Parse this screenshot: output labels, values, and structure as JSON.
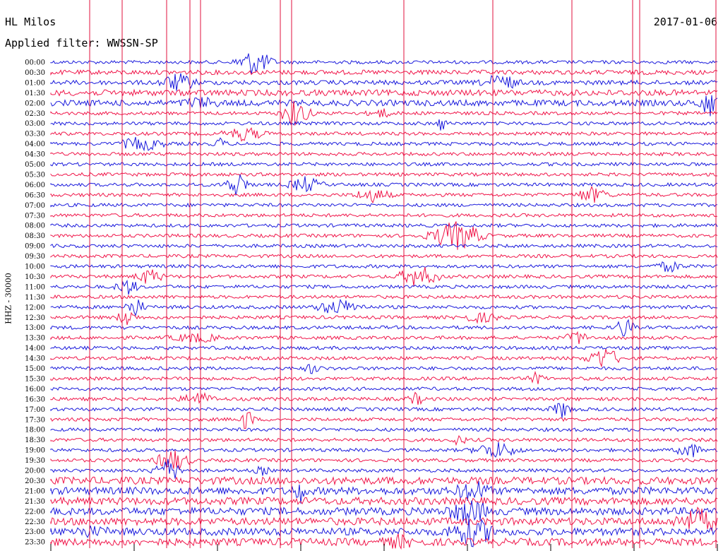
{
  "header": {
    "station": "HL Milos",
    "date": "2017-01-06",
    "filter": "Applied filter: WWSSN-SP"
  },
  "chart_data": {
    "type": "line",
    "title": "HL Milos",
    "ylabel": "HHZ - 30000",
    "time_labels": [
      "00:00",
      "00:30",
      "01:00",
      "01:30",
      "02:00",
      "02:30",
      "03:00",
      "03:30",
      "04:00",
      "04:30",
      "05:00",
      "05:30",
      "06:00",
      "06:30",
      "07:00",
      "07:30",
      "08:00",
      "08:30",
      "09:00",
      "09:30",
      "10:00",
      "10:30",
      "11:00",
      "11:30",
      "12:00",
      "12:30",
      "13:00",
      "13:30",
      "14:00",
      "14:30",
      "15:00",
      "15:30",
      "16:00",
      "16:30",
      "17:00",
      "17:30",
      "18:00",
      "18:30",
      "19:00",
      "19:30",
      "20:00",
      "20:30",
      "21:00",
      "21:30",
      "22:00",
      "22:30",
      "23:00",
      "23:30"
    ],
    "trace_colors": [
      "#1a1adc",
      "#f0164a"
    ],
    "marker_color": "#e0103c",
    "ticks_at_bottom_count": 9
  }
}
